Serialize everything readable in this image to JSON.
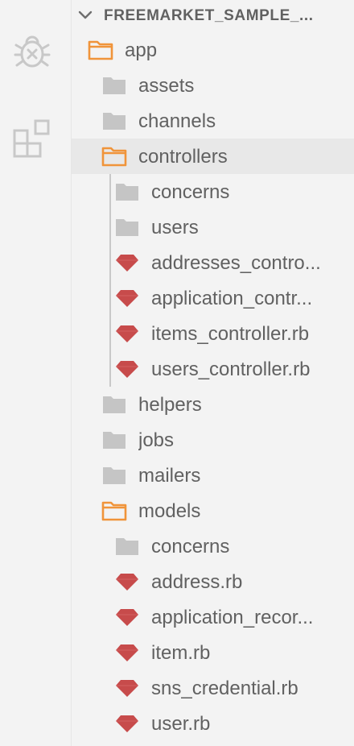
{
  "activity_bar": {
    "icons": [
      "debug-icon",
      "extensions-icon"
    ]
  },
  "explorer": {
    "section_title": "FREEMARKET_SAMPLE_...",
    "tree": [
      {
        "label": "app",
        "type": "folder-open",
        "depth": 0
      },
      {
        "label": "assets",
        "type": "folder",
        "depth": 1
      },
      {
        "label": "channels",
        "type": "folder",
        "depth": 1
      },
      {
        "label": "controllers",
        "type": "folder-open",
        "depth": 1,
        "selected": true
      },
      {
        "label": "concerns",
        "type": "folder",
        "depth": 2
      },
      {
        "label": "users",
        "type": "folder",
        "depth": 2
      },
      {
        "label": "addresses_contro...",
        "type": "ruby",
        "depth": 2
      },
      {
        "label": "application_contr...",
        "type": "ruby",
        "depth": 2
      },
      {
        "label": "items_controller.rb",
        "type": "ruby",
        "depth": 2
      },
      {
        "label": "users_controller.rb",
        "type": "ruby",
        "depth": 2
      },
      {
        "label": "helpers",
        "type": "folder",
        "depth": 1
      },
      {
        "label": "jobs",
        "type": "folder",
        "depth": 1
      },
      {
        "label": "mailers",
        "type": "folder",
        "depth": 1
      },
      {
        "label": "models",
        "type": "folder-open",
        "depth": 1
      },
      {
        "label": "concerns",
        "type": "folder",
        "depth": 2
      },
      {
        "label": "address.rb",
        "type": "ruby",
        "depth": 2
      },
      {
        "label": "application_recor...",
        "type": "ruby",
        "depth": 2
      },
      {
        "label": "item.rb",
        "type": "ruby",
        "depth": 2
      },
      {
        "label": "sns_credential.rb",
        "type": "ruby",
        "depth": 2
      },
      {
        "label": "user.rb",
        "type": "ruby",
        "depth": 2
      }
    ]
  },
  "colors": {
    "folder_open": "#f0943a",
    "folder_closed": "#c5c5c5",
    "ruby": "#c74b4b",
    "text": "#616161",
    "selected_row": "#e8e8e8"
  }
}
